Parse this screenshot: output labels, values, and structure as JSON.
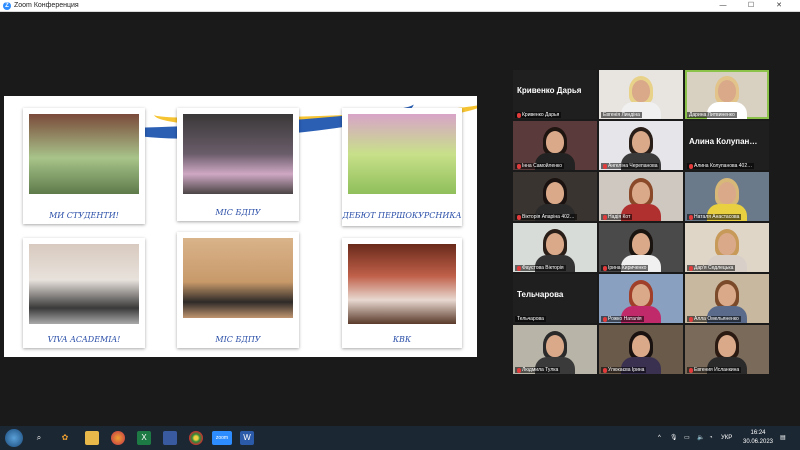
{
  "window": {
    "title": "Zoom Конференция"
  },
  "window_controls": {
    "minimize": "—",
    "maximize": "☐",
    "close": "✕"
  },
  "shared_slide": {
    "captions": [
      "МИ СТУДЕНТИ!",
      "МІС БДПУ",
      "ДЕБЮТ ПЕРШОКУРСНИКА",
      "VIVA ACADEMIA!",
      "МІС БДПУ",
      "КВК"
    ]
  },
  "participants": [
    {
      "name": "Кривенко Дарья",
      "display": "Кривенко Дарья",
      "video": false
    },
    {
      "name": "Евгенія Линдіна",
      "video": true
    },
    {
      "name": "Дарина Литвиненко",
      "video": true,
      "active": true
    },
    {
      "name": "Інна Самойленко",
      "video": true
    },
    {
      "name": "Ангеліна Черепанова",
      "video": true
    },
    {
      "name": "Алина Колупанова 402…",
      "display": "Алина Колупан…",
      "video": false
    },
    {
      "name": "Вікторія Апаріна 402…",
      "video": true
    },
    {
      "name": "Надія Кот",
      "video": true
    },
    {
      "name": "Наталя Анастасова",
      "video": true
    },
    {
      "name": "Фаустова Вікторія",
      "video": true
    },
    {
      "name": "Ірина Кириченко",
      "video": true
    },
    {
      "name": "Дар'я Седлецька",
      "video": true
    },
    {
      "name": "Тельчарова",
      "display": "Тельчарова",
      "video": false
    },
    {
      "name": "Рожко Наталія",
      "video": true
    },
    {
      "name": "Алла Омельяненко",
      "video": true
    },
    {
      "name": "Людмила Тулка",
      "video": true
    },
    {
      "name": "Улюкаєва Ірина",
      "video": true
    },
    {
      "name": "Евгения Исланкина",
      "video": true
    }
  ],
  "taskbar": {
    "language": "УКР",
    "time": "16:24",
    "date": "30.06.2023"
  }
}
